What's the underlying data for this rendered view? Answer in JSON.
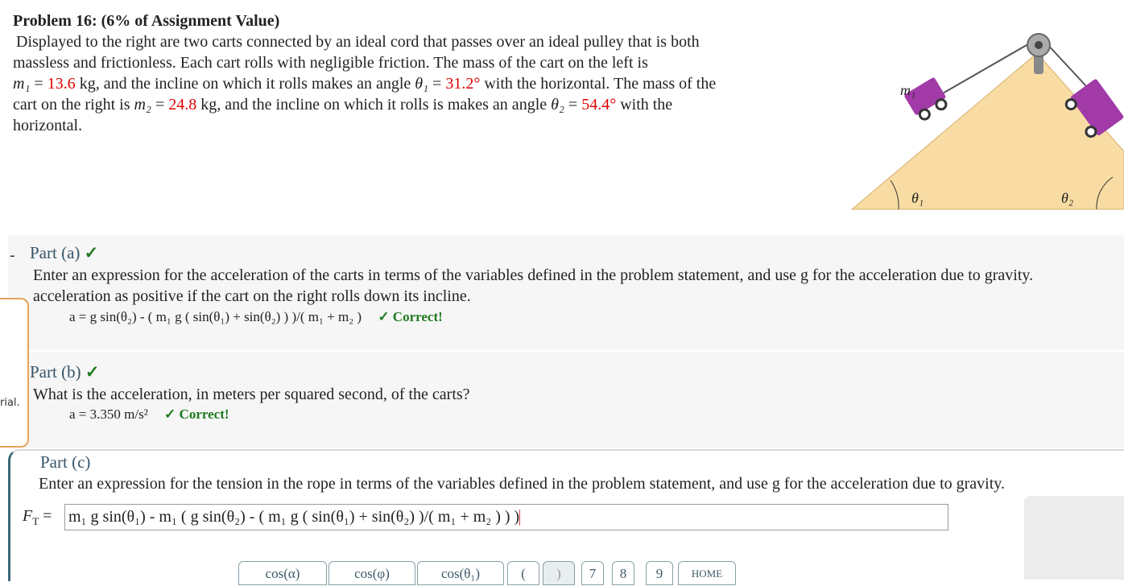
{
  "problem": {
    "title": "Problem 16: (6% of Assignment Value)",
    "line1": "Displayed to the right are two carts connected by an ideal cord that passes over an ideal pulley that is both",
    "line2": "massless and frictionless. Each cart rolls with negligible friction. The mass of the cart on the left is",
    "m1_sym": "m₁",
    "eq": " = ",
    "m1_value": "13.6",
    "m1_unit": " kg",
    "l3_mid": ", and the incline on which it rolls makes an angle ",
    "theta1_sym": "θ₁",
    "theta1_value": "31.2°",
    "l3_end": " with the horizontal. The mass of the",
    "l4_start": "cart on the right is ",
    "m2_sym": "m₂",
    "m2_value": "24.8",
    "m2_unit": " kg",
    "l4_mid": ", and the incline on which it rolls is makes an angle ",
    "theta2_sym": "θ₂",
    "theta2_value": "54.4°",
    "l4_end": " with the",
    "line5": "horizontal."
  },
  "figure": {
    "m1_label": "m₁",
    "theta1_label": "θ₁",
    "theta2_label": "θ₂"
  },
  "colors": {
    "part_title": "#375569",
    "red_value": "#e00000",
    "correct_green": "#1e7a1e",
    "incline_fill": "#f8dca3",
    "cart_purple": "#a23aa8"
  },
  "part_a": {
    "dash": "-",
    "title": "Part (a)",
    "check": "✓",
    "text_line1": "Enter an expression for the acceleration of the carts in terms of the variables defined in the problem statement, and use g for the acceleration due to gravity.",
    "text_line2": "acceleration as positive if the cart on the right rolls down its incline.",
    "answer": "a = g sin(θ₂) - ( m₁ g ( sin(θ₁) + sin(θ₂) ) )/( m₁ + m₂ )",
    "correct": "✓ Correct!"
  },
  "part_b": {
    "title": "Part (b)",
    "check": "✓",
    "text": "What is the acceleration, in meters per squared second, of the carts?",
    "answer": "a = 3.350 m/s²",
    "correct": "✓ Correct!"
  },
  "hint": {
    "text": "rial."
  },
  "part_c": {
    "title": "Part (c)",
    "text": "Enter an expression for the tension in the rope in terms of the variables defined in the problem statement, and use g for the acceleration due to gravity.",
    "label": "F",
    "label_sub": "T",
    "label_eq": " =",
    "input_value": "m₁ g sin(θ₁) - m₁ ( g sin(θ₂) - ( m₁ g ( sin(θ₁) + sin(θ₂) )/( m₁ + m₂ ) ) )"
  },
  "keypad": {
    "keys": [
      "cos(α)",
      "cos(φ)",
      "cos(θ₁)",
      "(",
      ")",
      "7",
      "8",
      "9",
      "HOME"
    ]
  }
}
